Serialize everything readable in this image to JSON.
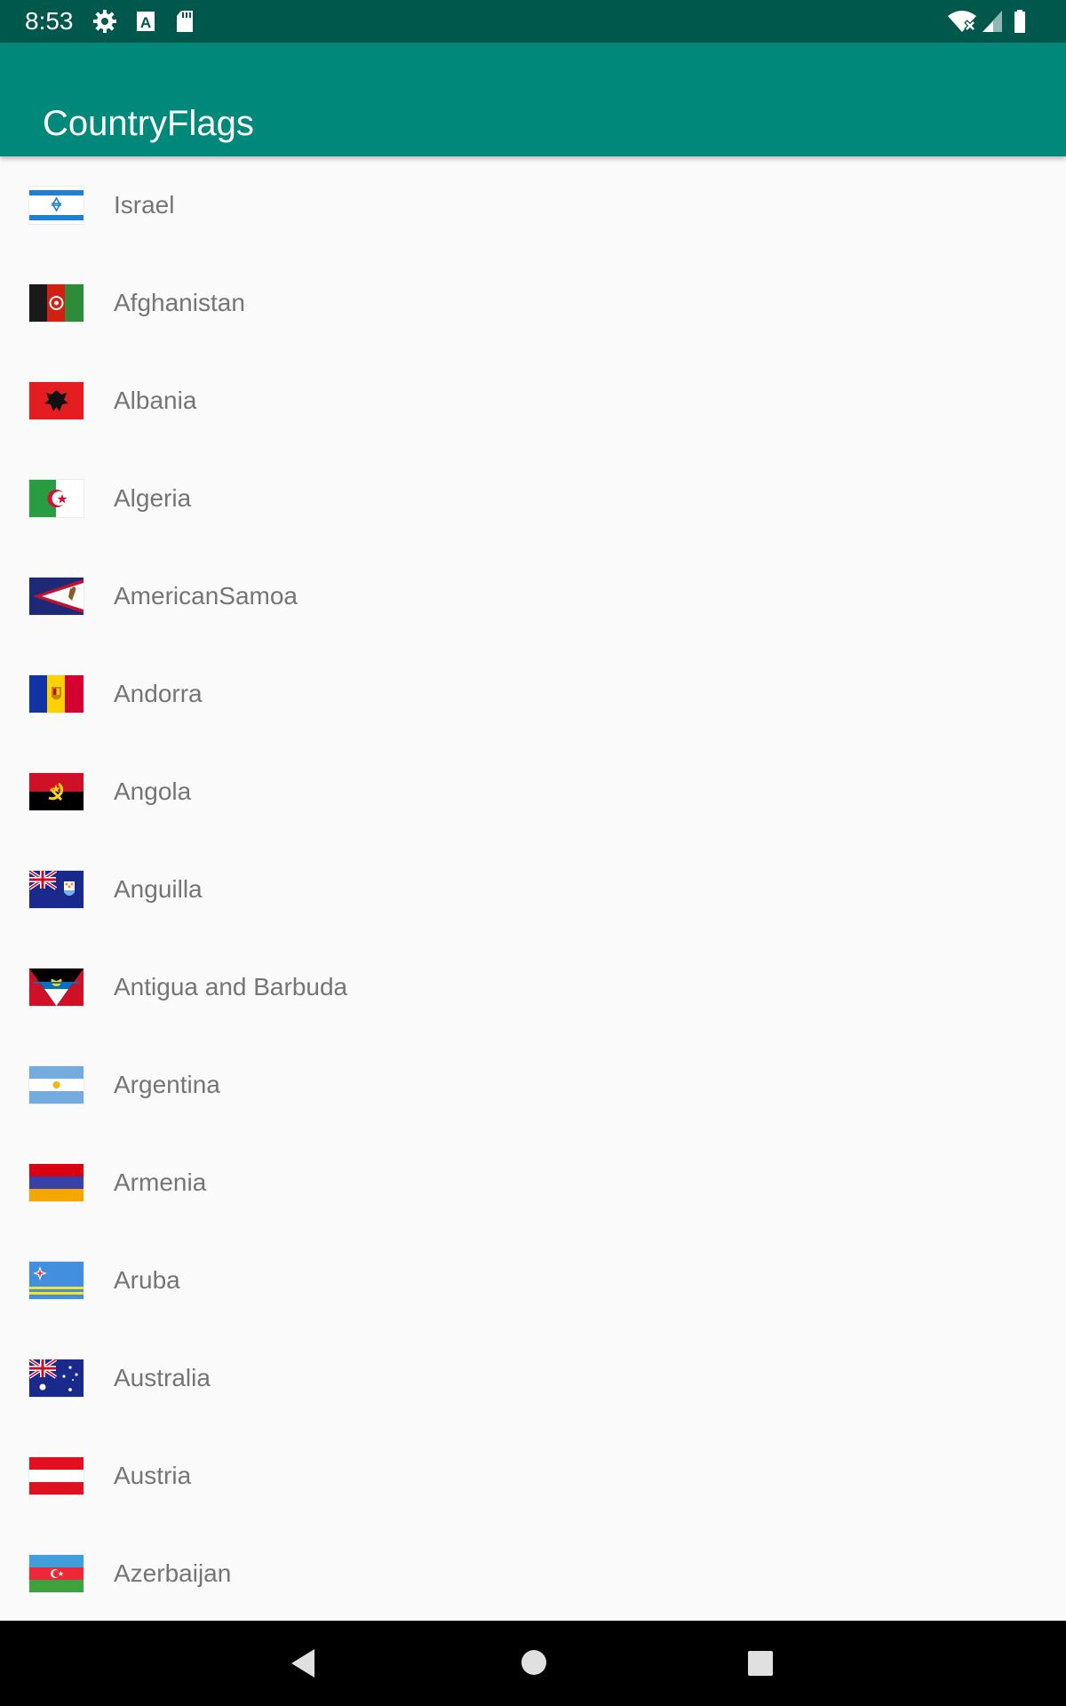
{
  "status_bar": {
    "time": "8:53",
    "left_icons": [
      "settings-gear-icon",
      "text-a-icon",
      "sd-card-icon"
    ],
    "right_icons": [
      "wifi-off-icon",
      "cell-signal-icon",
      "battery-icon"
    ],
    "color": "#00574b"
  },
  "app_bar": {
    "title": "CountryFlags",
    "color": "#00897b"
  },
  "countries": [
    {
      "name": "Israel",
      "flag": "israel-flag-icon"
    },
    {
      "name": "Afghanistan",
      "flag": "afghanistan-flag-icon"
    },
    {
      "name": "Albania",
      "flag": "albania-flag-icon"
    },
    {
      "name": "Algeria",
      "flag": "algeria-flag-icon"
    },
    {
      "name": "AmericanSamoa",
      "flag": "american-samoa-flag-icon"
    },
    {
      "name": "Andorra",
      "flag": "andorra-flag-icon"
    },
    {
      "name": "Angola",
      "flag": "angola-flag-icon"
    },
    {
      "name": "Anguilla",
      "flag": "anguilla-flag-icon"
    },
    {
      "name": "Antigua and Barbuda",
      "flag": "antigua-barbuda-flag-icon"
    },
    {
      "name": "Argentina",
      "flag": "argentina-flag-icon"
    },
    {
      "name": "Armenia",
      "flag": "armenia-flag-icon"
    },
    {
      "name": "Aruba",
      "flag": "aruba-flag-icon"
    },
    {
      "name": "Australia",
      "flag": "australia-flag-icon"
    },
    {
      "name": "Austria",
      "flag": "austria-flag-icon"
    },
    {
      "name": "Azerbaijan",
      "flag": "azerbaijan-flag-icon"
    }
  ],
  "nav_bar": {
    "buttons": [
      "back-icon",
      "home-icon",
      "recents-icon"
    ]
  }
}
